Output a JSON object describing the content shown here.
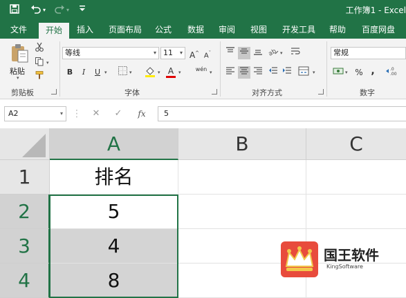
{
  "title_bar": {
    "document_title": "工作簿1 - Excel",
    "save_icon": "save-icon",
    "undo_icon": "undo-icon",
    "redo_icon": "redo-icon",
    "customize_icon": "customize-qat-icon"
  },
  "tabs": [
    {
      "label": "文件",
      "active": false
    },
    {
      "label": "开始",
      "active": true
    },
    {
      "label": "插入",
      "active": false
    },
    {
      "label": "页面布局",
      "active": false
    },
    {
      "label": "公式",
      "active": false
    },
    {
      "label": "数据",
      "active": false
    },
    {
      "label": "审阅",
      "active": false
    },
    {
      "label": "视图",
      "active": false
    },
    {
      "label": "开发工具",
      "active": false
    },
    {
      "label": "帮助",
      "active": false
    },
    {
      "label": "百度网盘",
      "active": false
    }
  ],
  "ribbon": {
    "clipboard": {
      "paste_label": "粘贴",
      "group_label": "剪贴板"
    },
    "font": {
      "font_name": "等线",
      "font_size": "11",
      "bold": "B",
      "italic": "I",
      "underline": "U",
      "grow_font": "A",
      "shrink_font": "A",
      "font_color_letter": "A",
      "phonetic": "wén",
      "group_label": "字体"
    },
    "alignment": {
      "group_label": "对齐方式"
    },
    "number": {
      "format": "常规",
      "percent": "%",
      "comma": ",",
      "group_label": "数字"
    }
  },
  "formula_bar": {
    "name_box": "A2",
    "fx_label": "fx",
    "formula_value": "5"
  },
  "sheet": {
    "columns": [
      "A",
      "B",
      "C"
    ],
    "rows": [
      "1",
      "2",
      "3",
      "4"
    ],
    "cells": {
      "A1": "排名",
      "A2": "5",
      "A3": "4",
      "A4": "8"
    },
    "selected_range": "A2:A4",
    "active_cell": "A2"
  },
  "watermark": {
    "name": "国王软件",
    "sub": "KingSoftware"
  },
  "colors": {
    "excel_green": "#217346",
    "selection_shade": "#d4d4d4",
    "watermark_red": "#e84b3c"
  }
}
